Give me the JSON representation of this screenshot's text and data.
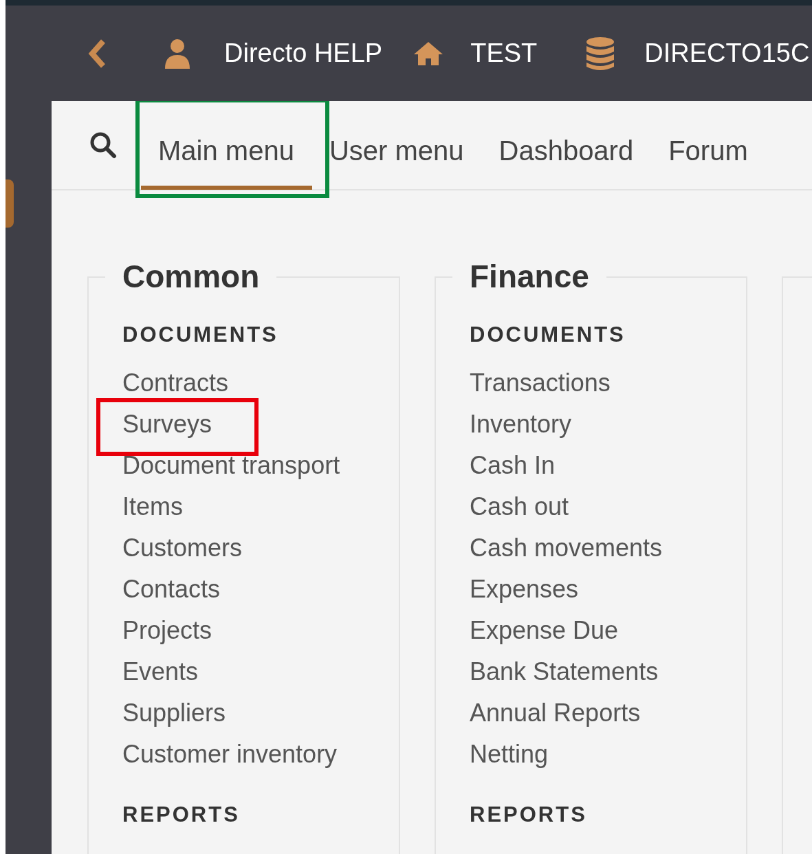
{
  "top_bar": {
    "user": "Directo HELP",
    "company": "TEST",
    "database": "DIRECTO15C"
  },
  "tabs": [
    {
      "label": "Main menu",
      "selected": true,
      "color": "#0a8a3f"
    },
    {
      "label": "User menu",
      "selected": false
    },
    {
      "label": "Dashboard",
      "selected": false
    },
    {
      "label": "Forum",
      "selected": false
    }
  ],
  "columns": [
    {
      "title": "Common",
      "sections": [
        {
          "heading": "DOCUMENTS",
          "items": [
            {
              "label": "Contracts"
            },
            {
              "label": "Surveys",
              "color": "#e8000b"
            },
            {
              "label": "Document transport"
            },
            {
              "label": "Items"
            },
            {
              "label": "Customers"
            },
            {
              "label": "Contacts"
            },
            {
              "label": "Projects"
            },
            {
              "label": "Events"
            },
            {
              "label": "Suppliers"
            },
            {
              "label": "Customer inventory"
            }
          ]
        },
        {
          "heading": "REPORTS"
        }
      ]
    },
    {
      "title": "Finance",
      "sections": [
        {
          "heading": "DOCUMENTS",
          "items": [
            {
              "label": "Transactions"
            },
            {
              "label": "Inventory"
            },
            {
              "label": "Cash In"
            },
            {
              "label": "Cash out"
            },
            {
              "label": "Cash movements"
            },
            {
              "label": "Expenses"
            },
            {
              "label": "Expense Due"
            },
            {
              "label": "Bank Statements"
            },
            {
              "label": "Annual Reports"
            },
            {
              "label": "Netting"
            }
          ]
        },
        {
          "heading": "REPORTS"
        }
      ]
    }
  ]
}
